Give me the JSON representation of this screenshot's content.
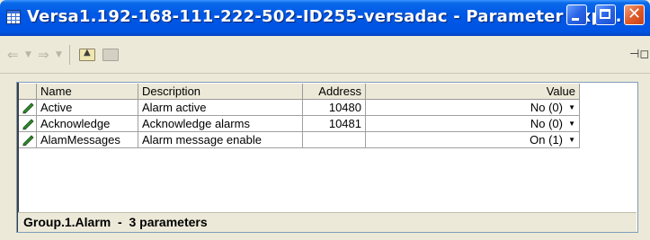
{
  "window": {
    "title": "Versa1.192-168-111-222-502-ID255-versadac - Parameter Exp...",
    "title_icon": "grid-table-icon",
    "buttons": [
      "minimize",
      "maximize",
      "close"
    ]
  },
  "toolbar": {
    "back_icon": "back-arrow-icon",
    "forward_icon": "forward-arrow-icon",
    "up_folder_icon": "folder-up-icon",
    "folder_icon": "folder-icon",
    "pin_icon": "pin-icon"
  },
  "table": {
    "columns": {
      "name": "Name",
      "description": "Description",
      "address": "Address",
      "value": "Value"
    },
    "rows": [
      {
        "icon": "pencil-icon",
        "name": "Active",
        "description": "Alarm active",
        "address": "10480",
        "value": "No (0)"
      },
      {
        "icon": "pencil-icon",
        "name": "Acknowledge",
        "description": "Acknowledge alarms",
        "address": "10481",
        "value": "No (0)"
      },
      {
        "icon": "pencil-icon",
        "name": "AlamMessages",
        "description": "Alarm message enable",
        "address": "",
        "value": "On (1)"
      }
    ]
  },
  "status": {
    "text": "Group.1.Alarm  -  3 parameters"
  }
}
